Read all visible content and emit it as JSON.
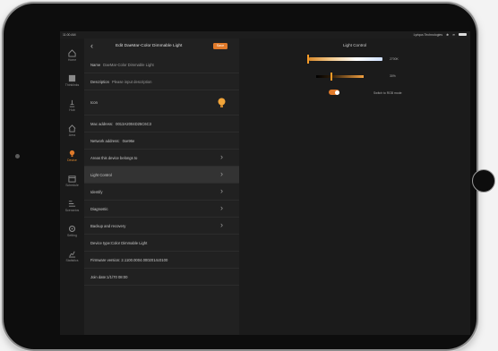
{
  "status": {
    "time": "11:00 AM",
    "carrier": "Lyriqus Technologies"
  },
  "rail": [
    {
      "id": "home",
      "label": "Home",
      "icon": "home-icon"
    },
    {
      "id": "thinklinks",
      "label": "Thinklinks",
      "icon": "grid-icon"
    },
    {
      "id": "hub",
      "label": "Hub",
      "icon": "hub-icon"
    },
    {
      "id": "area",
      "label": "Area",
      "icon": "area-icon"
    },
    {
      "id": "device",
      "label": "Device",
      "icon": "bulb-icon"
    },
    {
      "id": "schedule",
      "label": "Schedule",
      "icon": "calendar-icon"
    },
    {
      "id": "scenes",
      "label": "Scenarios",
      "icon": "scenes-icon"
    },
    {
      "id": "setting",
      "label": "Setting",
      "icon": "gear-icon"
    },
    {
      "id": "statistics",
      "label": "Statistics",
      "icon": "chart-icon"
    }
  ],
  "panel": {
    "title": "Edit DaeMar-Color Dimmable Light",
    "save_label": "Save",
    "name_label": "Name",
    "name_value": "DaeMar-Color Dimmable Light",
    "description_label": "Description",
    "description_placeholder": "Please input description",
    "icon_label": "Icon",
    "mac_label": "Mac address:",
    "mac_value": "0013A2004D25C6C3",
    "network_label": "Network address:",
    "network_value": "0xe96e",
    "rows": {
      "access": "Areas this device belongs to",
      "light_control": "Light Control",
      "identify": "Identify",
      "diagnostic": "Diagnostic",
      "backup": "Backup and recovery",
      "device_type": "Device type:Color Dimmable Light",
      "firmware": "Firmware version: 2.1100.0004.0002014c0100",
      "join_date": "Join date:1/1/70 08:00"
    }
  },
  "light_control": {
    "title": "Light Control",
    "cct_value": "2700K",
    "dim_value": "30%",
    "dim_level": 0.3,
    "rgb_mode_on": true,
    "switch_label": "Switch to RGB mode",
    "accent": "#e07a2a"
  }
}
